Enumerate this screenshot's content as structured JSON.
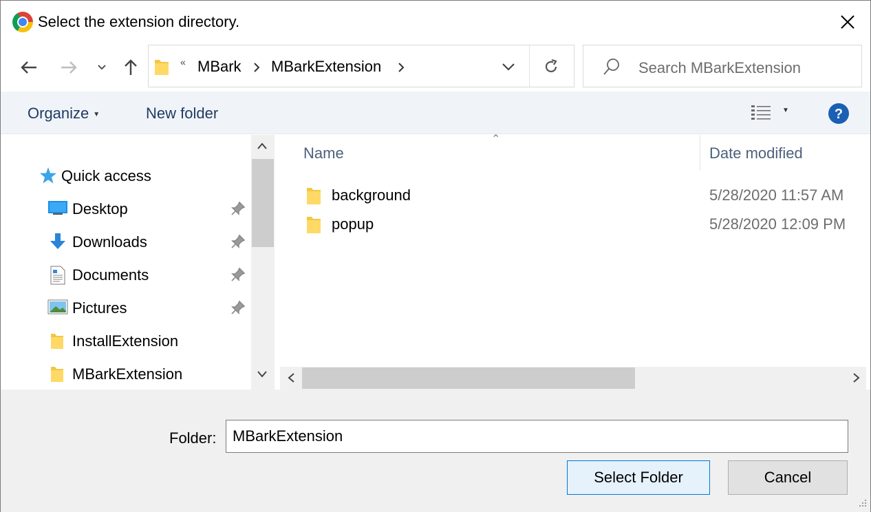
{
  "window": {
    "title": "Select the extension directory.",
    "app_icon": "chrome-icon",
    "close_icon": "close-icon"
  },
  "nav": {
    "back_icon": "back-arrow-icon",
    "forward_icon": "forward-arrow-icon",
    "recent_icon": "chevron-down-icon",
    "up_icon": "up-arrow-icon"
  },
  "address": {
    "overflow": "«",
    "crumbs": [
      "MBark",
      "MBarkExtension"
    ],
    "refresh_icon": "refresh-icon"
  },
  "search": {
    "placeholder": "Search MBarkExtension"
  },
  "toolbar": {
    "organize_label": "Organize",
    "new_folder_label": "New folder",
    "view_icon": "details-view-icon",
    "help_icon": "help-icon"
  },
  "sidebar": {
    "items": [
      {
        "label": "Quick access",
        "icon": "star-icon"
      },
      {
        "label": "Desktop",
        "icon": "desktop-icon",
        "pinned": true
      },
      {
        "label": "Downloads",
        "icon": "download-icon",
        "pinned": true
      },
      {
        "label": "Documents",
        "icon": "document-icon",
        "pinned": true
      },
      {
        "label": "Pictures",
        "icon": "pictures-icon",
        "pinned": true
      },
      {
        "label": "InstallExtension",
        "icon": "folder-icon",
        "pinned": false
      },
      {
        "label": "MBarkExtension",
        "icon": "folder-icon",
        "pinned": false
      }
    ]
  },
  "files": {
    "columns": [
      "Name",
      "Date modified"
    ],
    "rows": [
      {
        "name": "background",
        "date": "5/28/2020 11:57 AM"
      },
      {
        "name": "popup",
        "date": "5/28/2020 12:09 PM"
      }
    ]
  },
  "footer": {
    "folder_label": "Folder:",
    "folder_value": "MBarkExtension",
    "select_label": "Select Folder",
    "cancel_label": "Cancel"
  },
  "colors": {
    "accent": "#0078d7",
    "toolbar_bg": "#f0f4f9",
    "help_blue": "#1a5fb4"
  }
}
